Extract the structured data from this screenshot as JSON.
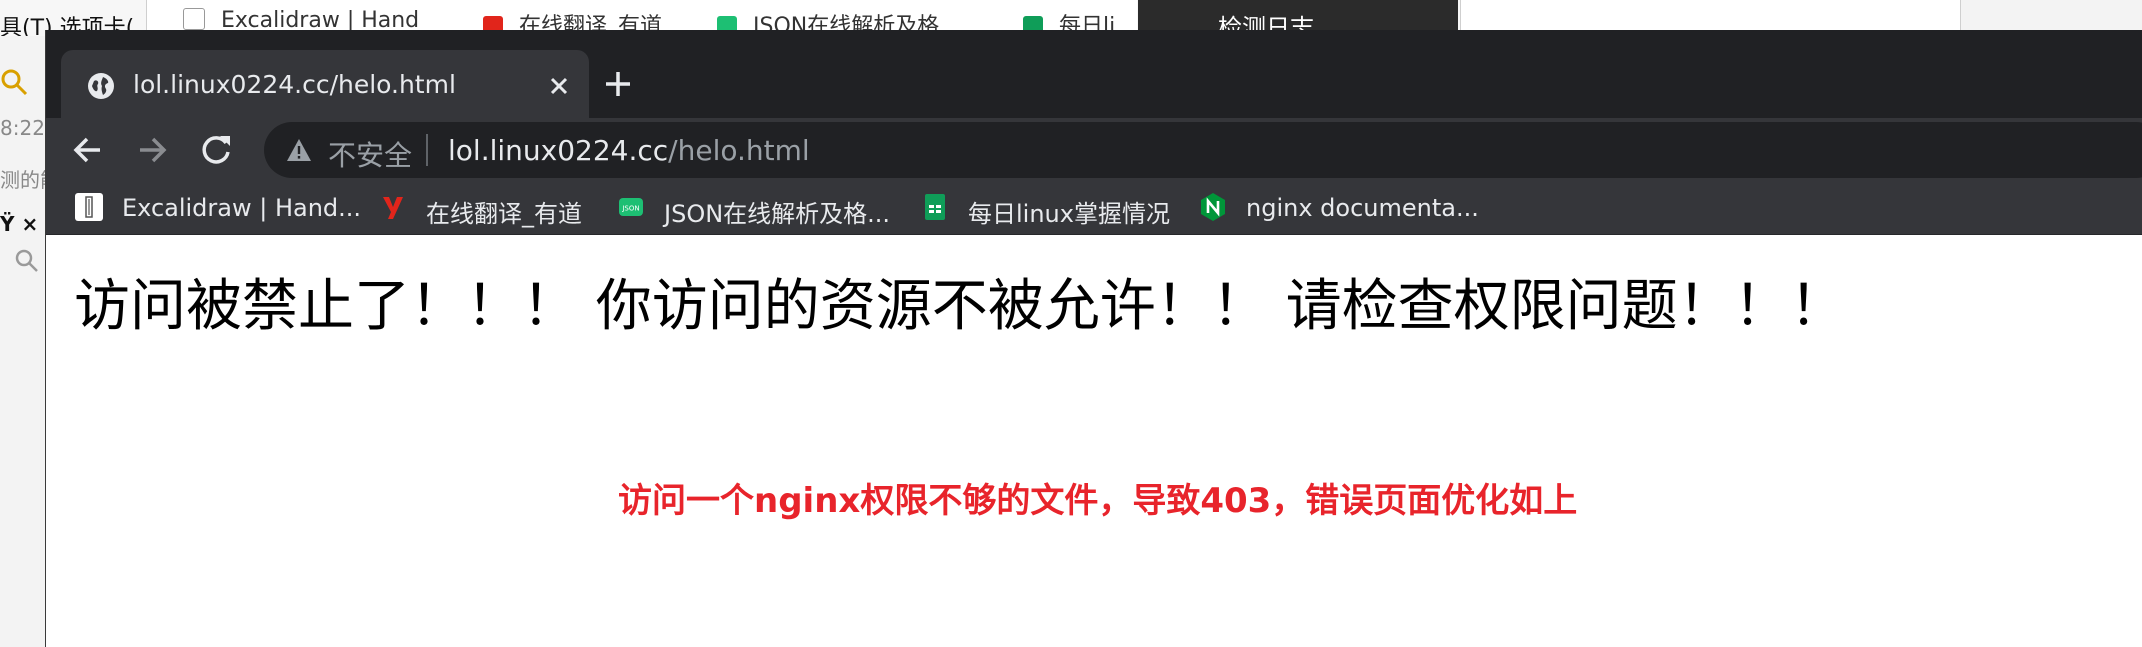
{
  "background_app": {
    "menu_text": "具(T)  选项卡(",
    "tabs": [
      {
        "label": "Excalidraw | Hand"
      },
      {
        "label": "在线翻译_有道"
      },
      {
        "label": "JSON在线解析及格"
      },
      {
        "label": "每日li"
      }
    ],
    "dark_panel_title": "检测日志",
    "left_fragments": [
      "8:22",
      "测的能",
      "Ÿ ×"
    ]
  },
  "browser": {
    "active_tab": {
      "title": "lol.linux0224.cc/helo.html",
      "favicon": "globe-icon",
      "close_icon": "close-icon"
    },
    "new_tab_icon": "plus-icon",
    "toolbar": {
      "back_icon": "arrow-left-icon",
      "forward_icon": "arrow-right-icon",
      "reload_icon": "reload-icon",
      "security_icon": "warning-triangle-icon",
      "security_label": "不安全",
      "url_host": "lol.linux0224.cc",
      "url_path": "/helo.html"
    },
    "bookmarks": [
      {
        "label": "Excalidraw | Hand...",
        "icon": "excalidraw-icon",
        "color": "#ffffff"
      },
      {
        "label": "在线翻译_有道",
        "icon": "youdao-icon",
        "color": "#e1251b"
      },
      {
        "label": "JSON在线解析及格...",
        "icon": "json-icon",
        "color": "#1dbf73"
      },
      {
        "label": "每日linux掌握情况",
        "icon": "sheets-icon",
        "color": "#0f9d58"
      },
      {
        "label": "nginx documenta...",
        "icon": "nginx-icon",
        "color": "#009639"
      }
    ]
  },
  "page": {
    "heading": "访问被禁止了！！！ 你访问的资源不被允许！！ 请检查权限问题！！！",
    "annotation": "访问一个nginx权限不够的文件，导致403，错误页面优化如上",
    "annotation_color": "#e8242b"
  }
}
